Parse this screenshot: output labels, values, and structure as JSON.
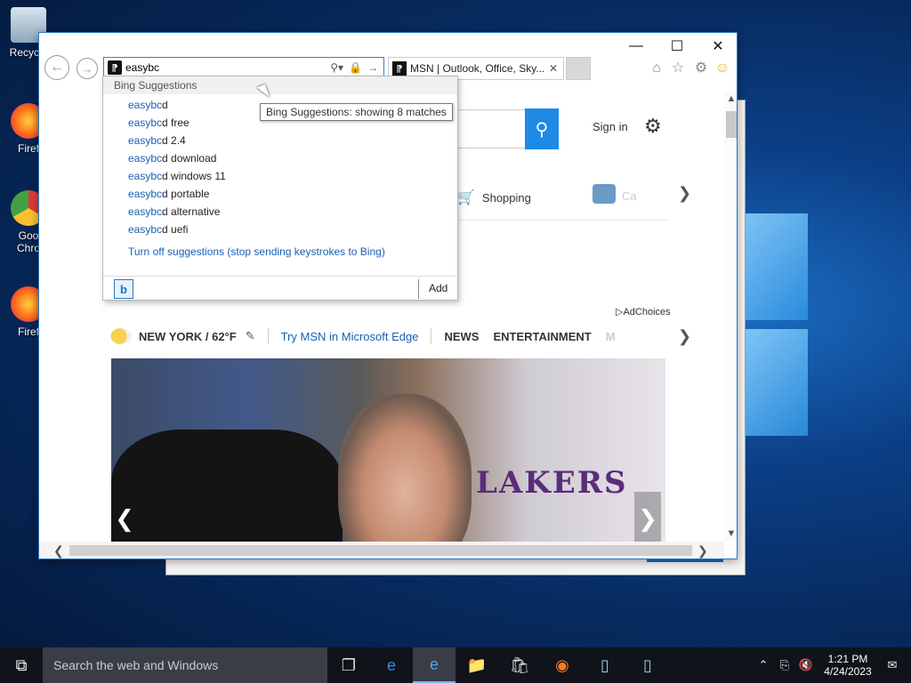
{
  "desktop": {
    "icons": [
      {
        "label": "Recycle",
        "name": "recycle-bin"
      },
      {
        "label": "Firef",
        "name": "firefox-shortcut-1"
      },
      {
        "label": "Goo Chro",
        "name": "chrome-shortcut"
      },
      {
        "label": "Firef",
        "name": "firefox-shortcut-2"
      }
    ]
  },
  "browser": {
    "address": "easybc",
    "tab_title": "MSN | Outlook, Office, Sky...",
    "window_buttons": {
      "minimize": "—",
      "maximize": "☐",
      "close": "✕"
    }
  },
  "suggestions": {
    "header": "Bing Suggestions",
    "items": [
      {
        "query": "easybc",
        "rest": "d"
      },
      {
        "query": "easybc",
        "rest": "d free"
      },
      {
        "query": "easybc",
        "rest": "d 2.4"
      },
      {
        "query": "easybc",
        "rest": "d download"
      },
      {
        "query": "easybc",
        "rest": "d windows 11"
      },
      {
        "query": "easybc",
        "rest": "d portable"
      },
      {
        "query": "easybc",
        "rest": "d alternative"
      },
      {
        "query": "easybc",
        "rest": "d uefi"
      }
    ],
    "turn_off": "Turn off suggestions (stop sending keystrokes to Bing)",
    "add_label": "Add",
    "tooltip": "Bing Suggestions: showing 8 matches"
  },
  "page": {
    "signin": "Sign in",
    "shopping": "Shopping",
    "cars_partial": "Ca",
    "adchoices": "AdChoices",
    "weather": "NEW YORK / 62°F",
    "try_edge": "Try MSN in Microsoft Edge",
    "nav": [
      "NEWS",
      "ENTERTAINMENT",
      "M"
    ],
    "hero_text": "LAKERS"
  },
  "taskbar": {
    "search_placeholder": "Search the web and Windows",
    "time": "1:21 PM",
    "date": "4/24/2023"
  },
  "colors": {
    "accent": "#1e8ae6",
    "link": "#1a5fb4",
    "taskbar": "#10131a"
  }
}
